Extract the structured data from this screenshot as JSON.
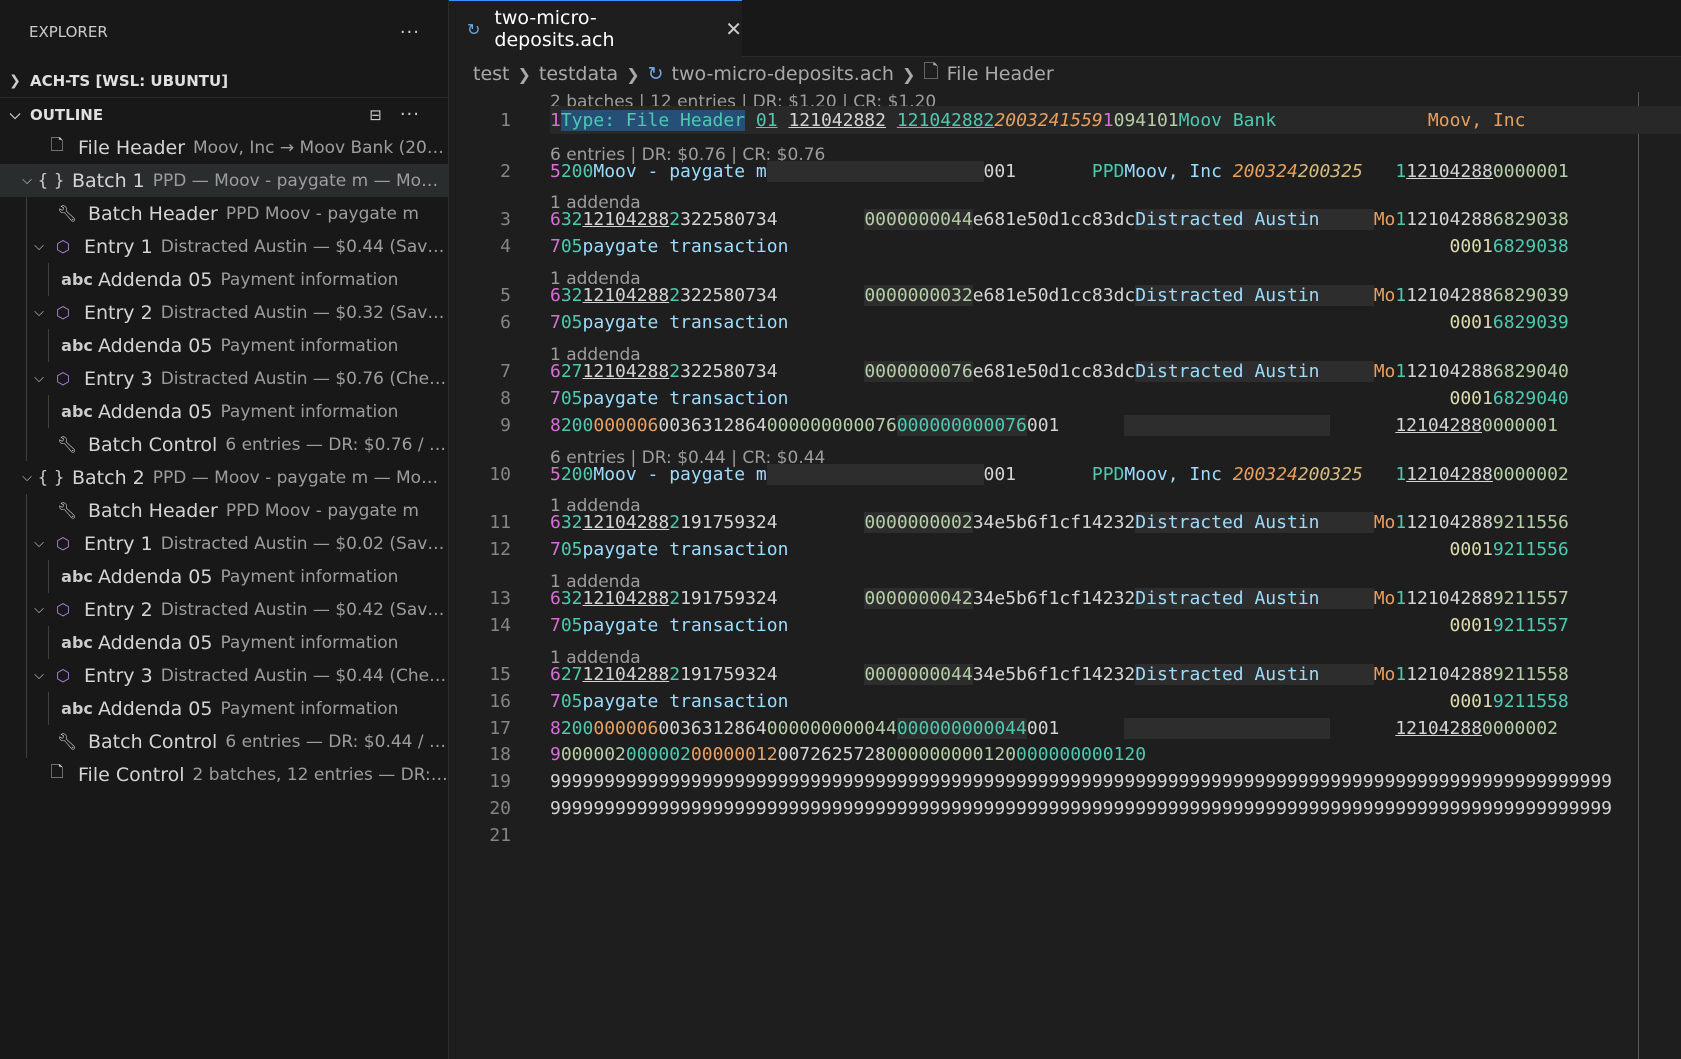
{
  "explorer": {
    "title": "EXPLORER",
    "more": "···"
  },
  "workspace": {
    "label": "ACH-TS [WSL: UBUNTU]"
  },
  "outline": {
    "label": "OUTLINE",
    "items": [
      {
        "label": "File Header",
        "desc": "Moov, Inc → Moov Bank (2020-..."
      },
      {
        "label": "Batch 1",
        "desc": "PPD — Moov - paygate m — Moov, ..."
      },
      {
        "label": "Batch Header",
        "desc": "PPD Moov - paygate m"
      },
      {
        "label": "Entry 1",
        "desc": "Distracted Austin — $0.44 (Savings ..."
      },
      {
        "label": "Addenda 05",
        "desc": "Payment information"
      },
      {
        "label": "Entry 2",
        "desc": "Distracted Austin — $0.32 (Savings ..."
      },
      {
        "label": "Addenda 05",
        "desc": "Payment information"
      },
      {
        "label": "Entry 3",
        "desc": "Distracted Austin — $0.76 (Checkin..."
      },
      {
        "label": "Addenda 05",
        "desc": "Payment information"
      },
      {
        "label": "Batch Control",
        "desc": "6 entries — DR: $0.76 / CR: ..."
      },
      {
        "label": "Batch 2",
        "desc": "PPD — Moov - paygate m — Moov, ..."
      },
      {
        "label": "Batch Header",
        "desc": "PPD Moov - paygate m"
      },
      {
        "label": "Entry 1",
        "desc": "Distracted Austin — $0.02 (Savings ..."
      },
      {
        "label": "Addenda 05",
        "desc": "Payment information"
      },
      {
        "label": "Entry 2",
        "desc": "Distracted Austin — $0.42 (Savings ..."
      },
      {
        "label": "Addenda 05",
        "desc": "Payment information"
      },
      {
        "label": "Entry 3",
        "desc": "Distracted Austin — $0.44 (Checkin..."
      },
      {
        "label": "Addenda 05",
        "desc": "Payment information"
      },
      {
        "label": "Batch Control",
        "desc": "6 entries — DR: $0.44 / CR: ..."
      },
      {
        "label": "File Control",
        "desc": "2 batches, 12 entries — DR: $1...."
      }
    ]
  },
  "tab": {
    "title": "two-micro-deposits.ach"
  },
  "breadcrumb": [
    "test",
    "testdata",
    "two-micro-deposits.ach",
    "File Header"
  ],
  "lenses": [
    "2 batches | 12 entries | DR: $1.20 | CR: $1.20",
    "6 entries | DR: $0.76 | CR: $0.76",
    "1 addenda",
    "1 addenda",
    "1 addenda",
    "6 entries | DR: $0.44 | CR: $0.44",
    "1 addenda",
    "1 addenda",
    "1 addenda"
  ],
  "line_numbers": [
    "1",
    "2",
    "3",
    "4",
    "5",
    "6",
    "7",
    "8",
    "9",
    "10",
    "11",
    "12",
    "13",
    "14",
    "15",
    "16",
    "17",
    "18",
    "19",
    "20",
    "21"
  ],
  "code": {
    "l1": [
      "1",
      "Type: File Header",
      "01",
      " ",
      "121042882",
      " ",
      "121042882",
      "2003241559",
      "1",
      "094101",
      "Moov Bank",
      "Moov, Inc"
    ],
    "l2": [
      "5",
      "200",
      "Moov - paygate m",
      "001",
      "PPD",
      "Moov, Inc ",
      "200324",
      "200325",
      "1",
      "12104288",
      "0000001"
    ],
    "l3": [
      "6",
      "32",
      "12104288",
      "2",
      "322580734",
      "0000000044",
      "e681e50d1cc83dc",
      "Distracted Austin",
      "Mo",
      "1",
      "12104288",
      "6829038"
    ],
    "l4": [
      "7",
      "05",
      "paygate transaction",
      "0001",
      "6829038"
    ],
    "l5": [
      "6",
      "32",
      "12104288",
      "2",
      "322580734",
      "0000000032",
      "e681e50d1cc83dc",
      "Distracted Austin",
      "Mo",
      "1",
      "12104288",
      "6829039"
    ],
    "l6": [
      "7",
      "05",
      "paygate transaction",
      "0001",
      "6829039"
    ],
    "l7": [
      "6",
      "27",
      "12104288",
      "2",
      "322580734",
      "0000000076",
      "e681e50d1cc83dc",
      "Distracted Austin",
      "Mo",
      "1",
      "12104288",
      "6829040"
    ],
    "l8": [
      "7",
      "05",
      "paygate transaction",
      "0001",
      "6829040"
    ],
    "l9": [
      "8",
      "200",
      "000006",
      "0036312864",
      "000000000076",
      "000000000076",
      "001",
      "12104288",
      "0000001"
    ],
    "l10": [
      "5",
      "200",
      "Moov - paygate m",
      "001",
      "PPD",
      "Moov, Inc ",
      "200324",
      "200325",
      "1",
      "12104288",
      "0000002"
    ],
    "l11": [
      "6",
      "32",
      "12104288",
      "2",
      "191759324",
      "0000000002",
      "34e5b6f1cf14232",
      "Distracted Austin",
      "Mo",
      "1",
      "12104288",
      "9211556"
    ],
    "l12": [
      "7",
      "05",
      "paygate transaction",
      "0001",
      "9211556"
    ],
    "l13": [
      "6",
      "32",
      "12104288",
      "2",
      "191759324",
      "0000000042",
      "34e5b6f1cf14232",
      "Distracted Austin",
      "Mo",
      "1",
      "12104288",
      "9211557"
    ],
    "l14": [
      "7",
      "05",
      "paygate transaction",
      "0001",
      "9211557"
    ],
    "l15": [
      "6",
      "27",
      "12104288",
      "2",
      "191759324",
      "0000000044",
      "34e5b6f1cf14232",
      "Distracted Austin",
      "Mo",
      "1",
      "12104288",
      "9211558"
    ],
    "l16": [
      "7",
      "05",
      "paygate transaction",
      "0001",
      "9211558"
    ],
    "l17": [
      "8",
      "200",
      "000006",
      "0036312864",
      "000000000044",
      "000000000044",
      "001",
      "12104288",
      "0000002"
    ],
    "l18": [
      "9",
      "000002",
      "000002",
      "00000012",
      "0072625728",
      "000000000120",
      "000000000120"
    ],
    "l19": "99999999999999999999999999999999999999999999999999999999999999999999999999999999999999999999999999",
    "l20": "99999999999999999999999999999999999999999999999999999999999999999999999999999999999999999999999999"
  }
}
